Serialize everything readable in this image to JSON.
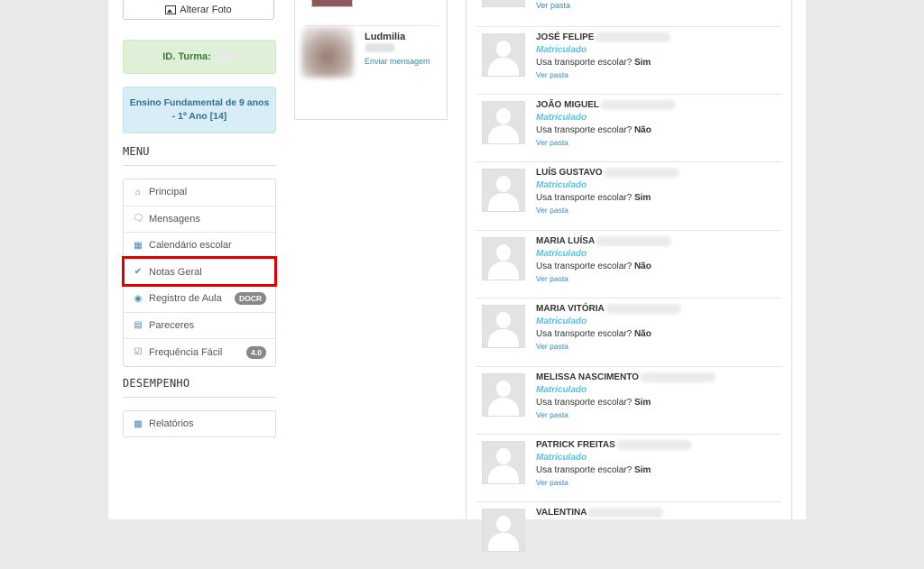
{
  "profile": {
    "alterar_foto_label": "Alterar Foto"
  },
  "turma": {
    "label": "ID. Turma:"
  },
  "ensino": {
    "text": "Ensino Fundamental de 9 anos - 1º Ano [14]"
  },
  "menu": {
    "title": "MENU",
    "items": [
      {
        "label": "Principal",
        "icon": "home-icon",
        "badge": ""
      },
      {
        "label": "Mensagens",
        "icon": "chat-icon",
        "badge": ""
      },
      {
        "label": "Calendário escolar",
        "icon": "calendar-icon",
        "badge": ""
      },
      {
        "label": "Notas Geral",
        "icon": "check-icon",
        "badge": ""
      },
      {
        "label": "Registro de Aula",
        "icon": "record-icon",
        "badge": "DOCR"
      },
      {
        "label": "Pareceres",
        "icon": "card-icon",
        "badge": ""
      },
      {
        "label": "Frequência Fácil",
        "icon": "checkbox-icon",
        "badge": "4.0"
      }
    ]
  },
  "desempenho": {
    "title": "DESEMPENHO",
    "items": [
      {
        "label": "Relatórios",
        "icon": "bar-chart-icon"
      }
    ]
  },
  "contact": {
    "name": "Ludmilia",
    "action": "Enviar mensagem"
  },
  "students": {
    "top_link": "Ver pasta",
    "transport_question": "Usa transporte escolar?",
    "link_label": "Ver pasta",
    "list": [
      {
        "name": "JOSÉ FELIPE",
        "status": "Matriculado",
        "transport": "Sim"
      },
      {
        "name": "JOÃO MIGUEL",
        "status": "Matriculado",
        "transport": "Não"
      },
      {
        "name": "LUÍS GUSTAVO",
        "status": "Matriculado",
        "transport": "Sim"
      },
      {
        "name": "MARIA LUÍSA",
        "status": "Matriculado",
        "transport": "Não"
      },
      {
        "name": "MARIA VITÓRIA",
        "status": "Matriculado",
        "transport": "Não"
      },
      {
        "name": "MELISSA NASCIMENTO",
        "status": "Matriculado",
        "transport": "Sim"
      },
      {
        "name": "PATRICK FREITAS",
        "status": "Matriculado",
        "transport": "Sim"
      },
      {
        "name": "VALENTINA",
        "status": "",
        "transport": ""
      }
    ]
  },
  "colors": {
    "highlight": "#e00000",
    "success_bg": "#dff0d8",
    "info_bg": "#d9edf7",
    "link": "#3a87ad",
    "status": "#5bc0de"
  }
}
